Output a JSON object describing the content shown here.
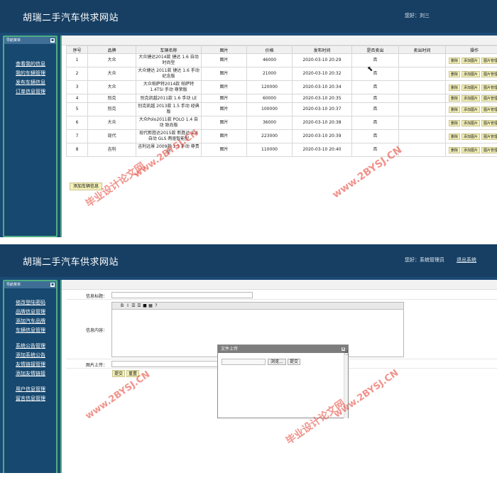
{
  "site_title": "胡瑞二手汽车供求网站",
  "screen1": {
    "greeting": "您好：刘三",
    "sidebar": {
      "header": "导航菜单",
      "toggle": "▪",
      "items": [
        "查看我的信息",
        "我的车辆管理",
        "发布车辆信息",
        "订单信息管理"
      ]
    },
    "table": {
      "headers": [
        "序号",
        "品牌",
        "车辆名称",
        "图片",
        "价格",
        "发布时间",
        "是否卖出",
        "卖出时间",
        "操作"
      ],
      "rows": [
        {
          "no": "1",
          "brand": "大众",
          "name": "大众捷达2014款 捷达 1.6 自动 时尚型",
          "img": "图片",
          "price": "46000",
          "time": "2020-03-10 20:29",
          "sold": "否",
          "sold_time": ""
        },
        {
          "no": "2",
          "brand": "大众",
          "name": "大众捷达 2011款 捷达 1.6 手动 纪念版",
          "img": "图片",
          "price": "21000",
          "time": "2020-03-10 20:32",
          "sold": "否",
          "sold_time": ""
        },
        {
          "no": "3",
          "brand": "大众",
          "name": "大众帕萨特2014款 帕萨特 1.4TSI 手动 尊荣版",
          "img": "图片",
          "price": "120000",
          "time": "2020-03-10 20:34",
          "sold": "否",
          "sold_time": ""
        },
        {
          "no": "4",
          "brand": "别克",
          "name": "别克凯越2011款 1.6 手动 LE",
          "img": "图片",
          "price": "60000",
          "time": "2020-03-10 20:35",
          "sold": "否",
          "sold_time": ""
        },
        {
          "no": "5",
          "brand": "别克",
          "name": "别克凯越 2013款 1.5 手动 经典版",
          "img": "图片",
          "price": "100000",
          "time": "2020-03-10 20:37",
          "sold": "否",
          "sold_time": ""
        },
        {
          "no": "6",
          "brand": "大众",
          "name": "大众Polo2011款 POLO 1.4 自动 致尚版",
          "img": "图片",
          "price": "36000",
          "time": "2020-03-10 20:38",
          "sold": "否",
          "sold_time": ""
        },
        {
          "no": "7",
          "brand": "现代",
          "name": "现代新胜达2015款 新胜达 2.4 自动 GLS 两驱智能型",
          "img": "图片",
          "price": "223000",
          "time": "2020-03-10 20:39",
          "sold": "否",
          "sold_time": ""
        },
        {
          "no": "8",
          "brand": "吉利",
          "name": "吉利远景 2009款 1.5 手动 尊贵型",
          "img": "图片",
          "price": "110000",
          "time": "2020-03-10 20:40",
          "sold": "否",
          "sold_time": ""
        }
      ],
      "actions": [
        "删除",
        "添加图片",
        "图片管理"
      ]
    },
    "add_button": "添加车辆信息"
  },
  "screen2": {
    "greeting": "您好：系统管理员",
    "logout": "退出系统",
    "sidebar": {
      "header": "导航菜单",
      "toggle": "▪",
      "groups": [
        [
          "修改登陆密码",
          "品牌信息管理",
          "添加汽车品牌",
          "车辆信息管理"
        ],
        [
          "系统公告管理",
          "添加系统公告",
          "友情链接管理",
          "添加友情链接"
        ],
        [
          "用户信息管理",
          "留言信息管理"
        ]
      ]
    },
    "form": {
      "title_label": "信息标题：",
      "content_label": "信息内容：",
      "image_label": "图片上传：",
      "submit": "提交",
      "reset": "重置",
      "toolbar": [
        "B",
        "I",
        "☰",
        "☰",
        "■",
        "▦",
        "?"
      ]
    },
    "dialog": {
      "title": "文件上传",
      "close": "✕",
      "browse": "浏览...",
      "submit": "提交"
    }
  },
  "watermarks": [
    "毕业设计论文网",
    "www.2BYSJ.CN"
  ],
  "colors": {
    "header_bg": "#173f63",
    "sidebar_bg": "#17486f",
    "sidebar_border": "#4dae84",
    "action_button_bg": "#f4f1b9",
    "watermark": "#e43b2f"
  }
}
